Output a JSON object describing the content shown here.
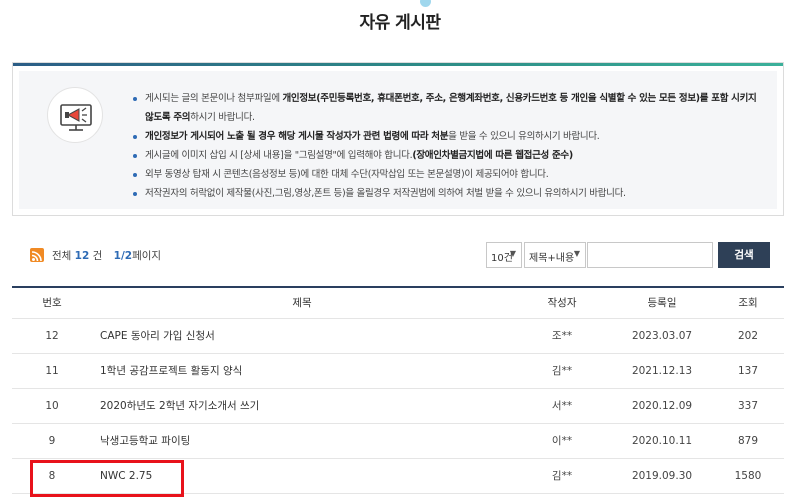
{
  "page": {
    "title": "자유 게시판"
  },
  "notice": {
    "items": [
      {
        "pre": "게시되는 글의 본문이나 첨부파일에 ",
        "bold": "개인정보(주민등록번호, 휴대폰번호, 주소, 은행계좌번호, 신용카드번호 등 개인을 식별할 수 있는 모든 정보)를 포함 시키지 않도록 주의",
        "post": "하시기 바랍니다."
      },
      {
        "pre": "",
        "bold": "개인정보가 게시되어 노출 될 경우 해당 게시물 작성자가 관련 법령에 따라 처분",
        "post": "을 받을 수 있으니 유의하시기 바랍니다."
      },
      {
        "pre": "게시글에 이미지 삽입 시 [상세 내용]을 \"그림설명\"에 입력해야 합니다.",
        "bold": "(장애인차별금지법에 따른 웹접근성 준수)",
        "post": ""
      },
      {
        "pre": "외부 동영상 탑재 시 콘텐츠(음성정보 등)에 대한 대체 수단(자막삽입 또는 본문설명)이 제공되어야 합니다.",
        "bold": "",
        "post": ""
      },
      {
        "pre": "저작권자의 허락없이 제작물(사진,그림,영상,폰트 등)을 올릴경우 저작권법에 의하여 처벌 받을 수 있으니 유의하시기 바랍니다.",
        "bold": "",
        "post": ""
      }
    ]
  },
  "summary": {
    "total_label": "전체",
    "total_count": "12",
    "total_unit": "건",
    "page_current": "1/2",
    "page_suffix": "페이지"
  },
  "search": {
    "count_option": "10건",
    "field_option": "제목+내용",
    "query": "",
    "button_label": "검색"
  },
  "table": {
    "headers": {
      "num": "번호",
      "title": "제목",
      "author": "작성자",
      "date": "등록일",
      "views": "조회"
    },
    "rows": [
      {
        "num": "12",
        "title": "CAPE 동아리 가입 신청서",
        "author": "조**",
        "date": "2023.03.07",
        "views": "202"
      },
      {
        "num": "11",
        "title": "1학년 공감프로젝트 활동지 양식",
        "author": "김**",
        "date": "2021.12.13",
        "views": "137"
      },
      {
        "num": "10",
        "title": "2020하년도 2학년 자기소개서 쓰기",
        "author": "서**",
        "date": "2020.12.09",
        "views": "337"
      },
      {
        "num": "9",
        "title": "낙생고등학교 파이팅",
        "author": "이**",
        "date": "2020.10.11",
        "views": "879"
      },
      {
        "num": "8",
        "title": "NWC 2.75",
        "author": "김**",
        "date": "2019.09.30",
        "views": "1580"
      }
    ]
  },
  "colors": {
    "accent": "#2e6bb5",
    "header_line": "#2a3f5f",
    "search_button": "#2e4057",
    "highlight": "#e8121b",
    "rss": "#f08a24"
  },
  "icons": {
    "notice": "megaphone-monitor-icon",
    "feed": "rss-icon"
  }
}
